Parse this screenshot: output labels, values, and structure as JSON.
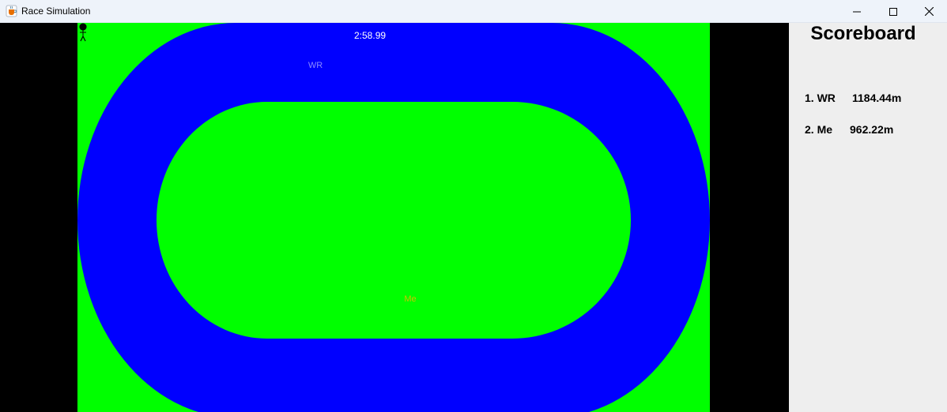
{
  "window": {
    "title": "Race Simulation",
    "icons": {
      "app": "java-cup-icon",
      "minimize": "minimize-icon",
      "maximize": "maximize-icon",
      "close": "close-icon"
    }
  },
  "race": {
    "timer": "2:58.99",
    "colors": {
      "grass": "#00ff00",
      "track": "#0000ff",
      "background": "#000000"
    },
    "runners": [
      {
        "label": "WR",
        "color": "#8a8aff"
      },
      {
        "label": "Me",
        "color": "#c9c400"
      }
    ]
  },
  "scoreboard": {
    "title": "Scoreboard",
    "rows": [
      {
        "rank": "1. WR",
        "distance": "1184.44m"
      },
      {
        "rank": "2. Me",
        "distance": "962.22m"
      }
    ]
  }
}
